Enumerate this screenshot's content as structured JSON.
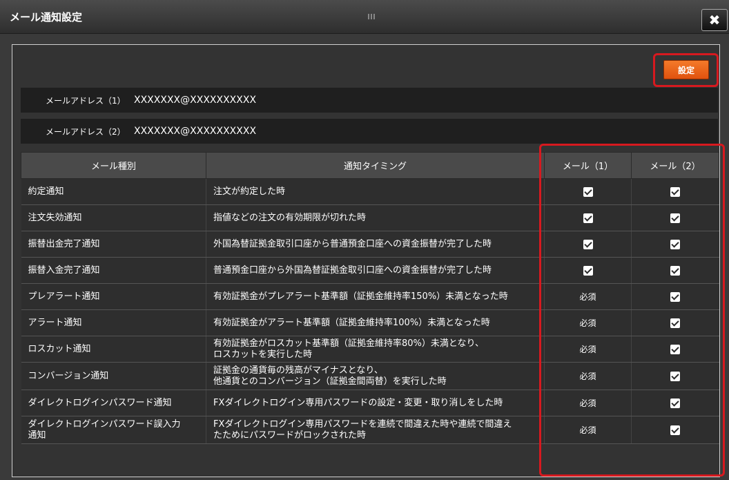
{
  "window": {
    "title": "メール通知設定",
    "close_label": "✖"
  },
  "toolbar": {
    "set_label": "設定"
  },
  "addresses": [
    {
      "label": "メールアドレス（1）",
      "value": "XXXXXXX@XXXXXXXXXX"
    },
    {
      "label": "メールアドレス（2）",
      "value": "XXXXXXX@XXXXXXXXXX"
    }
  ],
  "table": {
    "headers": [
      "メール種別",
      "通知タイミング",
      "メール（1）",
      "メール（2）"
    ],
    "required_text": "必須",
    "rows": [
      {
        "type": "約定通知",
        "timing": "注文が約定した時",
        "timing2": "",
        "mail1": "checked",
        "mail2": "checked"
      },
      {
        "type": "注文失効通知",
        "timing": "指値などの注文の有効期限が切れた時",
        "timing2": "",
        "mail1": "checked",
        "mail2": "checked"
      },
      {
        "type": "振替出金完了通知",
        "timing": "外国為替証拠金取引口座から普通預金口座への資金振替が完了した時",
        "timing2": "",
        "mail1": "checked",
        "mail2": "checked"
      },
      {
        "type": "振替入金完了通知",
        "timing": "普通預金口座から外国為替証拠金取引口座への資金振替が完了した時",
        "timing2": "",
        "mail1": "checked",
        "mail2": "checked"
      },
      {
        "type": "プレアラート通知",
        "timing": "有効証拠金がプレアラート基準額（証拠金維持率150%）未満となった時",
        "timing2": "",
        "mail1": "required",
        "mail2": "checked"
      },
      {
        "type": "アラート通知",
        "timing": "有効証拠金がアラート基準額（証拠金維持率100%）未満となった時",
        "timing2": "",
        "mail1": "required",
        "mail2": "checked"
      },
      {
        "type": "ロスカット通知",
        "timing": "有効証拠金がロスカット基準額（証拠金維持率80%）未満となり、",
        "timing2": "ロスカットを実行した時",
        "mail1": "required",
        "mail2": "checked"
      },
      {
        "type": "コンバージョン通知",
        "timing": "証拠金の通貨毎の残高がマイナスとなり、",
        "timing2": "他通貨とのコンバージョン（証拠金間両替）を実行した時",
        "mail1": "required",
        "mail2": "checked"
      },
      {
        "type": "ダイレクトログインパスワード通知",
        "timing": "FXダイレクトログイン専用パスワードの設定・変更・取り消しをした時",
        "timing2": "",
        "mail1": "required",
        "mail2": "checked"
      },
      {
        "type": "ダイレクトログインパスワード誤入力",
        "type2": "通知",
        "timing": "FXダイレクトログイン専用パスワードを連続で間違えた時や連続で間違え",
        "timing2": "たためにパスワードがロックされた時",
        "mail1": "required",
        "mail2": "checked"
      }
    ]
  },
  "colors": {
    "accent_orange": "#f47a2a",
    "highlight_red": "#d7191f",
    "panel_bg": "#333333"
  }
}
